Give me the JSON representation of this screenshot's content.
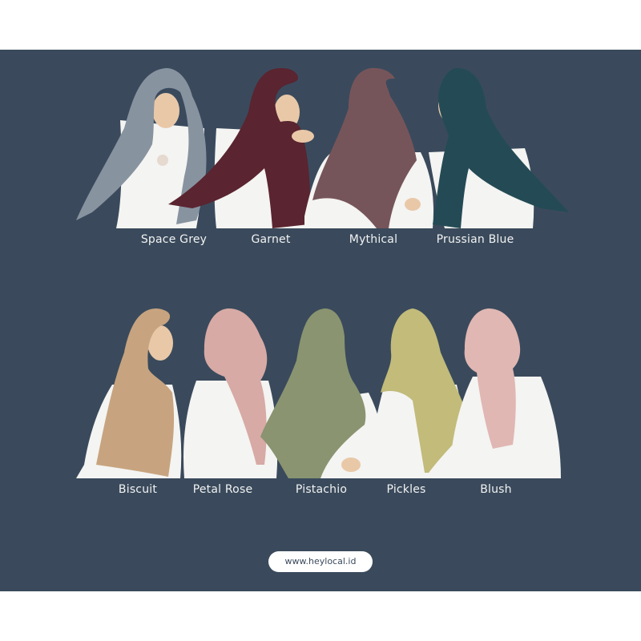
{
  "colors": {
    "background": "#3a4a5c",
    "space_grey": "#8893a0",
    "garnet": "#5a2430",
    "mythical": "#76555a",
    "prussian_blue": "#244b55",
    "biscuit": "#c7a47f",
    "petal_rose": "#d7aaa5",
    "pistachio": "#8a9470",
    "pickles": "#c2bb7a",
    "blush": "#e0b7b3",
    "dress": "#f4f4f2",
    "skin": "#e9c8a8"
  },
  "rows": [
    {
      "items": [
        {
          "label": "Space Grey",
          "color_key": "space_grey"
        },
        {
          "label": "Garnet",
          "color_key": "garnet"
        },
        {
          "label": "Mythical",
          "color_key": "mythical"
        },
        {
          "label": "Prussian Blue",
          "color_key": "prussian_blue"
        }
      ]
    },
    {
      "items": [
        {
          "label": "Biscuit",
          "color_key": "biscuit"
        },
        {
          "label": "Petal Rose",
          "color_key": "petal_rose"
        },
        {
          "label": "Pistachio",
          "color_key": "pistachio"
        },
        {
          "label": "Pickles",
          "color_key": "pickles"
        },
        {
          "label": "Blush",
          "color_key": "blush"
        }
      ]
    }
  ],
  "website": "www.heylocal.id"
}
